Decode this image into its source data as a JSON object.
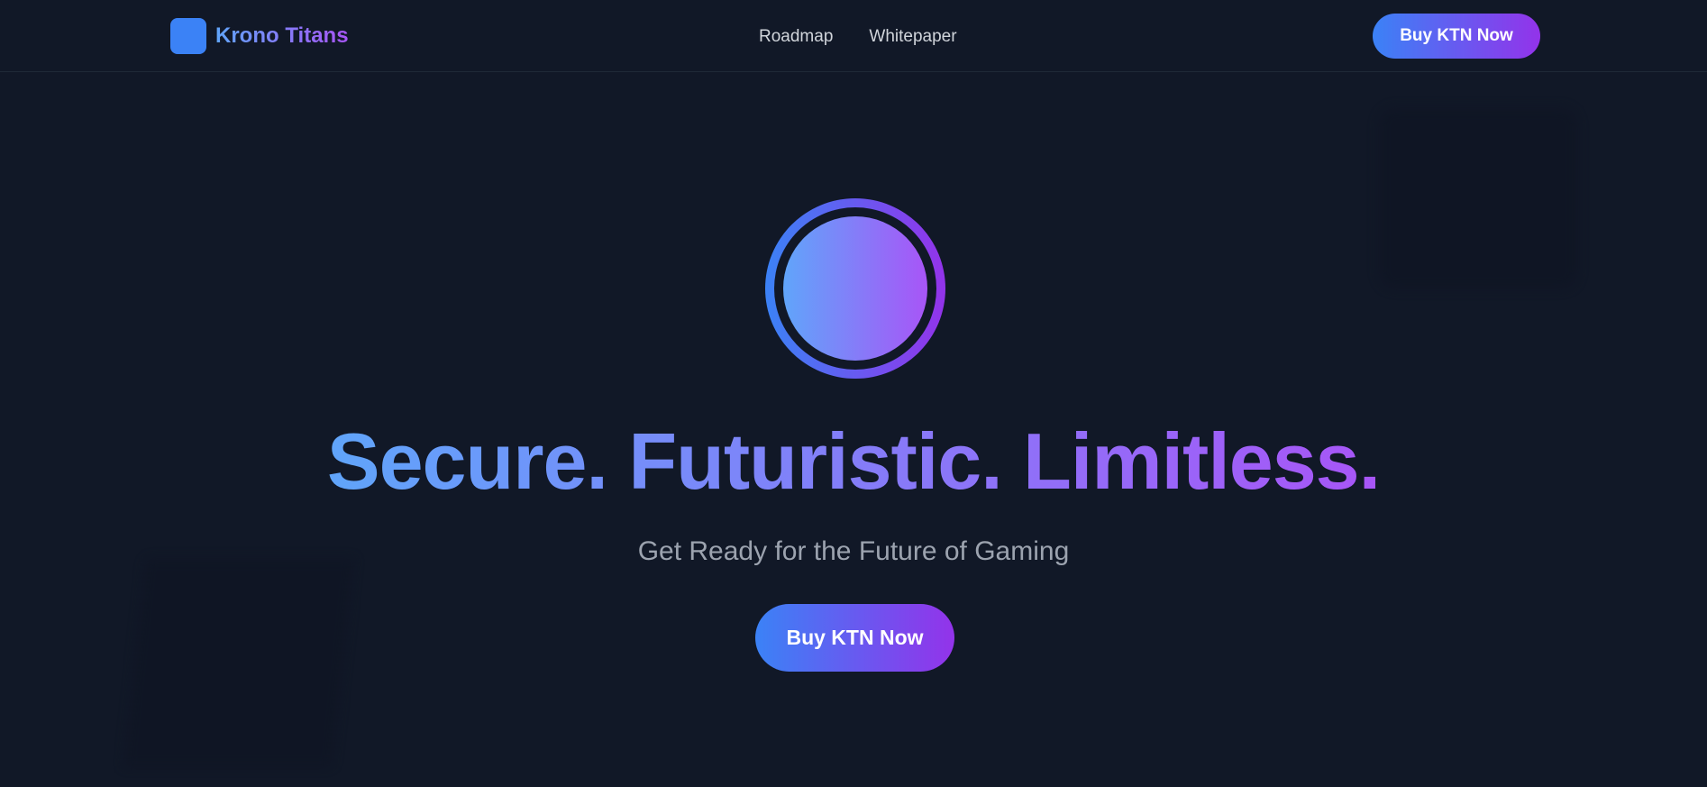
{
  "header": {
    "brand": "Krono Titans",
    "nav": [
      {
        "label": "Roadmap"
      },
      {
        "label": "Whitepaper"
      }
    ],
    "cta_label": "Buy KTN Now"
  },
  "hero": {
    "title": "Secure. Futuristic. Limitless.",
    "subtitle": "Get Ready for the Future of Gaming",
    "cta_label": "Buy KTN Now"
  },
  "colors": {
    "background": "#111827",
    "gradient_start": "#3b82f6",
    "gradient_end": "#9333ea",
    "text_muted": "#9ca3af"
  }
}
